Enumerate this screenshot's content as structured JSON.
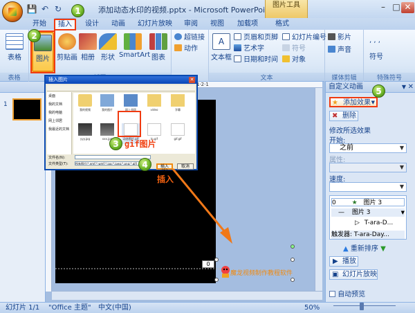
{
  "window": {
    "title": "添加动态水印的视频.pptx - Microsoft PowerPoint",
    "context_tab": "图片工具"
  },
  "tabs": [
    {
      "label": "开始"
    },
    {
      "label": "插入"
    },
    {
      "label": "设计"
    },
    {
      "label": "动画"
    },
    {
      "label": "幻灯片放映"
    },
    {
      "label": "审阅"
    },
    {
      "label": "视图"
    },
    {
      "label": "加载项"
    },
    {
      "label": "格式"
    }
  ],
  "ribbon": {
    "table_group": {
      "label": "表格",
      "table_btn": "表格"
    },
    "illus_group": {
      "label": "插图",
      "picture": "图片",
      "clipart": "剪贴画",
      "album": "相册",
      "shapes": "形状",
      "smartart": "SmartArt",
      "chart": "图表"
    },
    "links_group": {
      "hyperlink": "超链接",
      "action": "动作"
    },
    "text_group": {
      "label": "文本",
      "textbox": "文本框",
      "header_footer": "页眉和页脚",
      "wordart": "艺术字",
      "datetime": "日期和时间",
      "slide_number": "幻灯片编号",
      "symbol": "符号",
      "object": "对象"
    },
    "media_group": {
      "label": "媒体剪辑",
      "movie": "影片",
      "sound": "声音"
    },
    "special_group": {
      "label": "特殊符号",
      "symbol": "符号"
    }
  },
  "dialog": {
    "title": "插入图片",
    "places": [
      "桌面",
      "我的文档",
      "我的电脑",
      "网上邻居",
      "我最近的文档"
    ],
    "files": [
      "我的视频",
      "我的图片",
      "网上邻居",
      "video",
      "字幕",
      "yyy.jpg",
      "xxx.jpg",
      "动态图片.gif",
      "lp.gif",
      "gif.gif"
    ],
    "filename_label": "文件名(N):",
    "filetype_label": "文件类型(T):",
    "filetype_value": "所有图片(*.emf;*.wmf;*.jpg;*.jpeg;*.png;*.gif)",
    "insert_btn": "插入(S)",
    "cancel_btn": "取消"
  },
  "annotations": {
    "gif_label": "gif图片",
    "insert_label": "插入",
    "steps": [
      "1",
      "2",
      "3",
      "4",
      "5"
    ]
  },
  "slide": {
    "page_number": "0",
    "watermark": "魔龙视频制作教程软件"
  },
  "ruler_readout": "1·2·1",
  "slide_panel": {
    "slide_num": "1"
  },
  "taskpane": {
    "title": "自定义动画",
    "add_effect": "添加效果",
    "remove": "删除",
    "modify_label": "修改所选效果",
    "start_label": "开始:",
    "start_value": "之前",
    "property_label": "属性:",
    "speed_label": "速度:",
    "effects": [
      {
        "num": "0",
        "name": "图片 3"
      },
      {
        "num": "",
        "name": "图片 3"
      },
      {
        "num": "",
        "name": "T-ara-D..."
      }
    ],
    "trigger": "触发器: T-ara-Day...",
    "reorder": "重新排序",
    "play": "播放",
    "slideshow": "幻灯片放映",
    "autopreview": "自动预览"
  },
  "status": {
    "slide": "幻灯片 1/1",
    "theme": "\"Office 主题\"",
    "lang": "中文(中国)",
    "zoom": "50%"
  },
  "colors": {
    "accent_orange": "#f08a10",
    "callout_green": "#70b82a",
    "ribbon_blue": "#15428b"
  }
}
